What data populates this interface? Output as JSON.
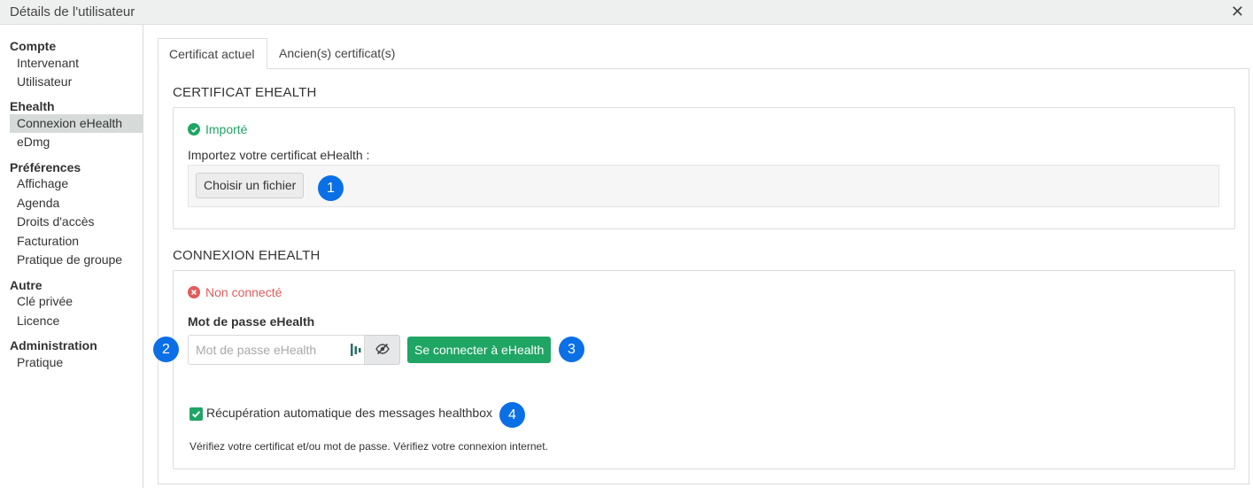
{
  "window": {
    "title": "Détails de l'utilisateur",
    "close_glyph": "✕"
  },
  "sidebar": {
    "groups": [
      {
        "title": "Compte",
        "items": [
          "Intervenant",
          "Utilisateur"
        ]
      },
      {
        "title": "Ehealth",
        "items": [
          "Connexion eHealth",
          "eDmg"
        ],
        "active_item": "Connexion eHealth"
      },
      {
        "title": "Préférences",
        "items": [
          "Affichage",
          "Agenda",
          "Droits d'accès",
          "Facturation",
          "Pratique de groupe"
        ]
      },
      {
        "title": "Autre",
        "items": [
          "Clé privée",
          "Licence"
        ]
      },
      {
        "title": "Administration",
        "items": [
          "Pratique"
        ]
      }
    ]
  },
  "tabs": [
    {
      "label": "Certificat actuel",
      "active": true
    },
    {
      "label": "Ancien(s) certificat(s)",
      "active": false
    }
  ],
  "certificate": {
    "section_title": "CERTIFICAT EHEALTH",
    "status": "Importé",
    "import_label": "Importez votre certificat eHealth :",
    "file_button": "Choisir un fichier"
  },
  "connection": {
    "section_title": "CONNEXION EHEALTH",
    "status": "Non connecté",
    "password_label": "Mot de passe eHealth",
    "password_placeholder": "Mot de passe eHealth",
    "connect_button": "Se connecter à eHealth",
    "auto_fetch_label": "Récupération automatique des messages healthbox",
    "auto_fetch_checked": true,
    "hint": "Vérifiez votre certificat et/ou mot de passe. Vérifiez votre connexion internet."
  },
  "markers": [
    "1",
    "2",
    "3",
    "4"
  ],
  "colors": {
    "success": "#1fa564",
    "error": "#e25c5c",
    "marker": "#0b6fe6",
    "active_sidebar": "#d6dbd9"
  },
  "icons": {
    "close": "close-icon",
    "imported": "check-circle-icon",
    "not_connected": "x-circle-icon",
    "key": "password-manager-icon",
    "eye": "eye-slash-icon",
    "checkbox": "check-icon"
  }
}
